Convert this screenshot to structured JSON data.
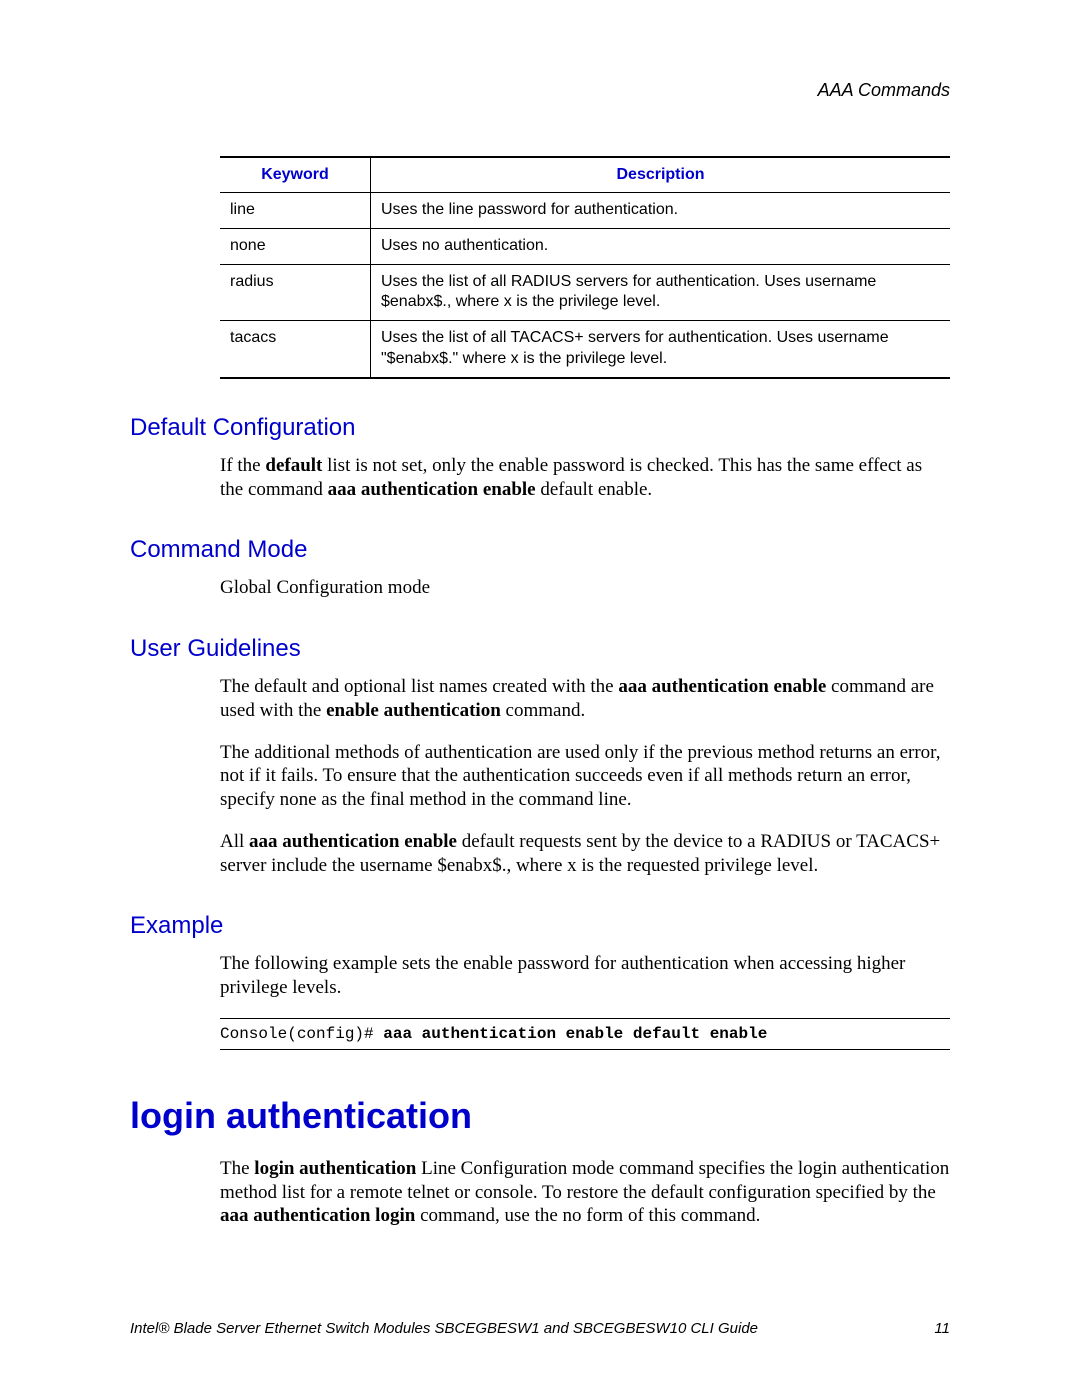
{
  "header": {
    "section_title": "AAA Commands"
  },
  "table": {
    "headers": {
      "keyword": "Keyword",
      "description": "Description"
    },
    "rows": [
      {
        "keyword": "line",
        "description": "Uses the line password for authentication."
      },
      {
        "keyword": "none",
        "description": "Uses no authentication."
      },
      {
        "keyword": "radius",
        "description": "Uses the list of all RADIUS servers for authentication. Uses username $enabx$., where x is the privilege level."
      },
      {
        "keyword": "tacacs",
        "description": "Uses the list of all TACACS+ servers for authentication. Uses username \"$enabx$.\" where x is the privilege level."
      }
    ]
  },
  "sections": {
    "default_config": {
      "heading": "Default Configuration",
      "p1_a": "If the ",
      "p1_b": "default",
      "p1_c": " list is not set, only the enable password is checked. This has the same effect as the command ",
      "p1_d": "aaa authentication enable",
      "p1_e": " default enable."
    },
    "command_mode": {
      "heading": "Command Mode",
      "p1": "Global Configuration mode"
    },
    "user_guidelines": {
      "heading": "User Guidelines",
      "p1_a": "The default and optional list names created with the ",
      "p1_b": "aaa authentication enable",
      "p1_c": " command are used with the ",
      "p1_d": "enable authentication",
      "p1_e": " command.",
      "p2": "The additional methods of authentication are used only if the previous method returns an error, not if it fails. To ensure that the authentication succeeds even if all methods return an error, specify none as the final method in the command line.",
      "p3_a": "All ",
      "p3_b": "aaa authentication enable",
      "p3_c": " default requests sent by the device to a RADIUS or TACACS+ server include the username $enabx$., where x is the requested privilege level."
    },
    "example": {
      "heading": "Example",
      "p1": "The following example sets the enable password for authentication when accessing higher privilege levels.",
      "code_a": "Console(config)# ",
      "code_b": "aaa authentication enable default enable"
    },
    "login_auth": {
      "heading": "login authentication",
      "p1_a": "The ",
      "p1_b": "login authentication",
      "p1_c": " Line Configuration mode command specifies the login authentication method list for a remote telnet or console. To restore the default configuration specified by the ",
      "p1_d": "aaa authentication login",
      "p1_e": " command, use the no form of this command."
    }
  },
  "footer": {
    "title": "Intel® Blade Server Ethernet Switch Modules SBCEGBESW1 and SBCEGBESW10 CLI Guide",
    "page": "11"
  }
}
